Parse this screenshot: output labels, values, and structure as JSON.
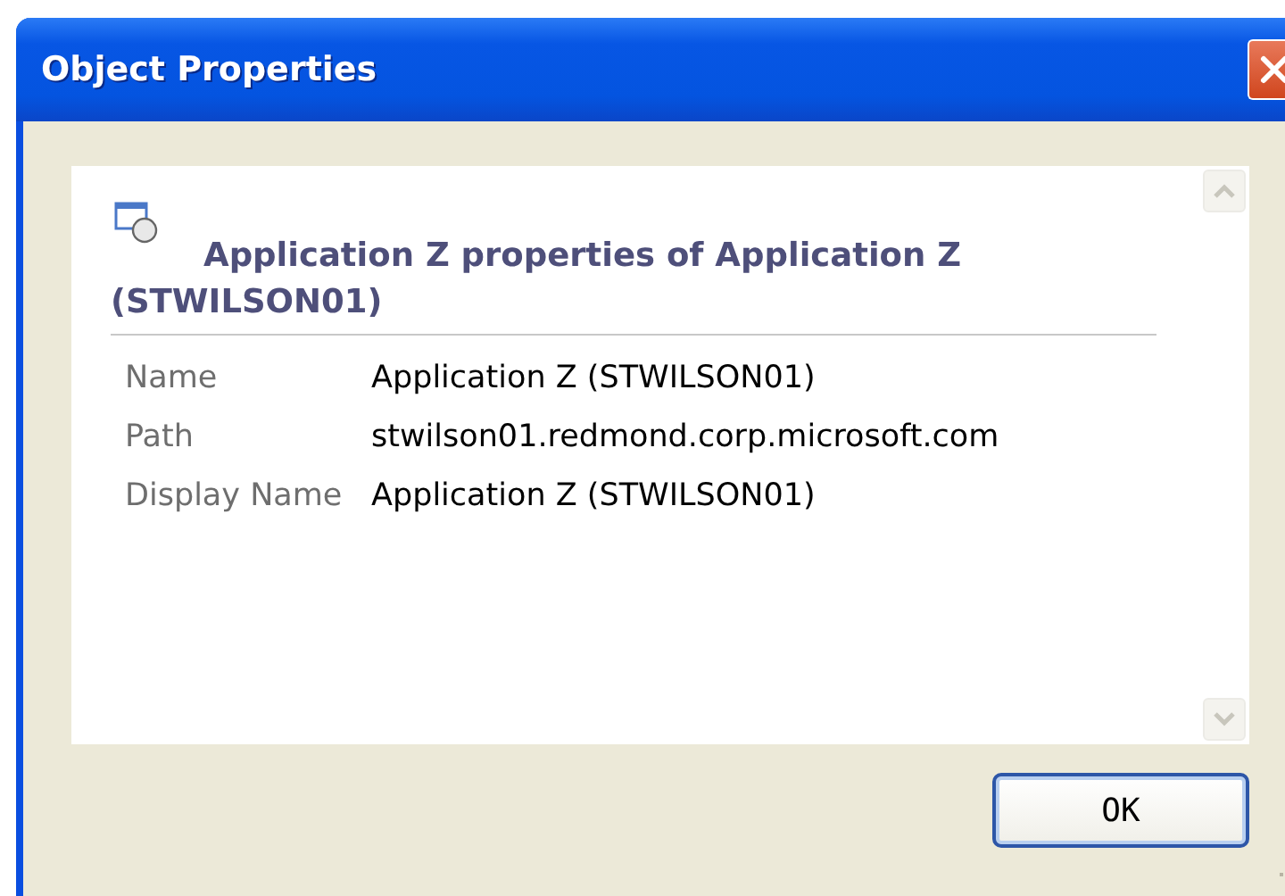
{
  "window": {
    "title": "Object Properties"
  },
  "heading": "Application Z properties of Application Z (STWILSON01)",
  "properties": [
    {
      "label": "Name",
      "value": "Application Z (STWILSON01)"
    },
    {
      "label": "Path",
      "value": "stwilson01.redmond.corp.microsoft.com"
    },
    {
      "label": "Display Name",
      "value": "Application Z (STWILSON01)"
    }
  ],
  "buttons": [
    "OK"
  ]
}
